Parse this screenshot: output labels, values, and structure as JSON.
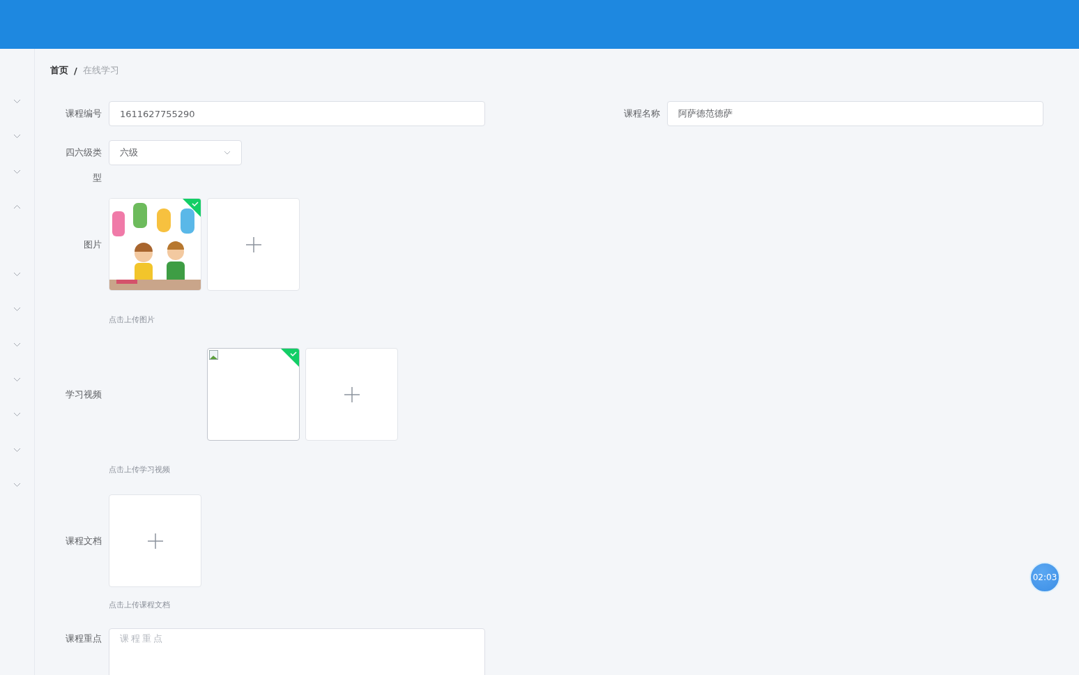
{
  "sidebar": {
    "items": [
      {
        "expanded": false
      },
      {
        "expanded": false
      },
      {
        "expanded": false
      },
      {
        "expanded": true
      },
      {
        "expanded": false
      },
      {
        "expanded": false
      },
      {
        "expanded": false
      },
      {
        "expanded": false
      },
      {
        "expanded": false
      },
      {
        "expanded": false
      },
      {
        "expanded": false
      }
    ]
  },
  "breadcrumb": [
    {
      "label": "首页",
      "selected": false
    },
    {
      "label": "在线学习",
      "selected": true
    }
  ],
  "breadcrumb_separator": "/",
  "form": {
    "top_fields": [
      {
        "label": "课程编号",
        "value": "1611627755290"
      },
      {
        "label": "课程名称",
        "value": "阿萨德范德萨"
      }
    ],
    "level_select": {
      "label": "四六级类型",
      "value": "六级"
    },
    "uploads": [
      {
        "label": "图片",
        "files": [
          {
            "kind": "picture",
            "done": true
          }
        ],
        "hint": "点击上传图片"
      },
      {
        "label": "学习视频",
        "files": [
          {
            "kind": "broken",
            "done": true
          }
        ],
        "hint": "点击上传学习视频"
      },
      {
        "label": "课程文档",
        "hint": "点击上传课程文档"
      }
    ],
    "textarea": {
      "label": "课程重点",
      "placeholder": "课程重点"
    }
  },
  "timer": "02:03"
}
